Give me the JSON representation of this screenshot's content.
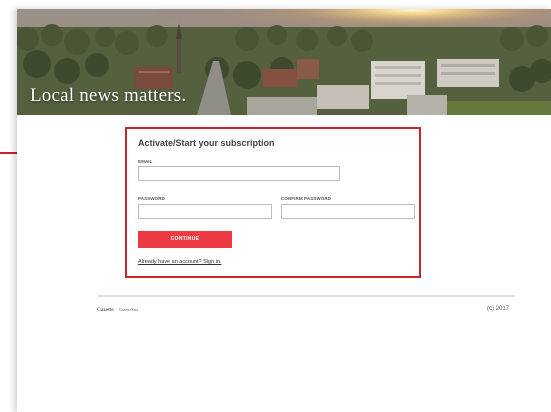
{
  "hero": {
    "tagline": "Local news matters."
  },
  "form": {
    "title": "Activate/Start your subscription",
    "email_label": "EMAIL",
    "email_value": "",
    "password_label": "PASSWORD",
    "password_value": "",
    "confirm_password_label": "CONFIRM PASSWORD",
    "confirm_password_value": "",
    "continue_label": "CONTINUE",
    "signin_link": "Already have an account? Sign in."
  },
  "footer": {
    "logo_primary": "Gazette",
    "logo_secondary": "GazetteXtra",
    "copyright": "(c) 2017"
  },
  "colors": {
    "accent": "#ee3a43",
    "callout_border": "#c8262e"
  }
}
